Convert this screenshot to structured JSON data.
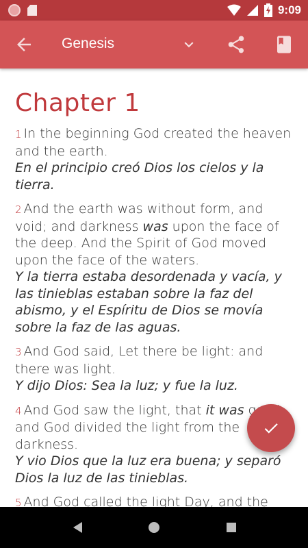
{
  "status_bar": {
    "time": "9:09",
    "icons": [
      "notification-dot-icon",
      "sd-card-icon",
      "wifi-icon",
      "cellular-icon",
      "battery-charging-icon"
    ]
  },
  "toolbar": {
    "title": "Genesis",
    "back_icon": "arrow-left-icon",
    "dropdown_icon": "chevron-down-icon",
    "share_icon": "share-icon",
    "bookmark_icon": "book-icon"
  },
  "chapter": {
    "title": "Chapter 1",
    "verses": [
      {
        "num": "1",
        "en_parts": [
          {
            "text": "In the beginning God created the heaven and the earth.",
            "italic": false
          }
        ],
        "es": "En el principio creó Dios los cielos y la tierra."
      },
      {
        "num": "2",
        "en_parts": [
          {
            "text": "And the earth was without form, and void; and darkness ",
            "italic": false
          },
          {
            "text": "was",
            "italic": true
          },
          {
            "text": " upon the face of the deep. And the Spirit of God moved upon the face of the waters.",
            "italic": false
          }
        ],
        "es": "Y la tierra estaba desordenada y vacía, y las tinieblas estaban sobre la faz del abismo, y el Espíritu de Dios se movía sobre la faz de las aguas."
      },
      {
        "num": "3",
        "en_parts": [
          {
            "text": "And God said, Let there be light: and there was light.",
            "italic": false
          }
        ],
        "es": "Y dijo Dios: Sea la luz; y fue la luz."
      },
      {
        "num": "4",
        "en_parts": [
          {
            "text": "And God saw the light, that ",
            "italic": false
          },
          {
            "text": "it was",
            "italic": true
          },
          {
            "text": " good: and God divided the light from the darkness.",
            "italic": false
          }
        ],
        "es": "Y vio Dios que la luz era buena; y separó Dios la luz de las tinieblas."
      },
      {
        "num": "5",
        "en_parts": [
          {
            "text": "And God called the light Day, and the darkness he called Night. And the evening and the morning were the first day.",
            "italic": false
          }
        ],
        "es": ""
      }
    ]
  },
  "fab": {
    "icon": "checkmark-icon"
  },
  "nav_bar": {
    "icons": [
      "back-triangle-icon",
      "home-circle-icon",
      "recents-square-icon"
    ]
  },
  "colors": {
    "status_bar": "#b5393c",
    "toolbar": "#d35456",
    "accent": "#c0393c",
    "fab": "#c44b4d"
  }
}
